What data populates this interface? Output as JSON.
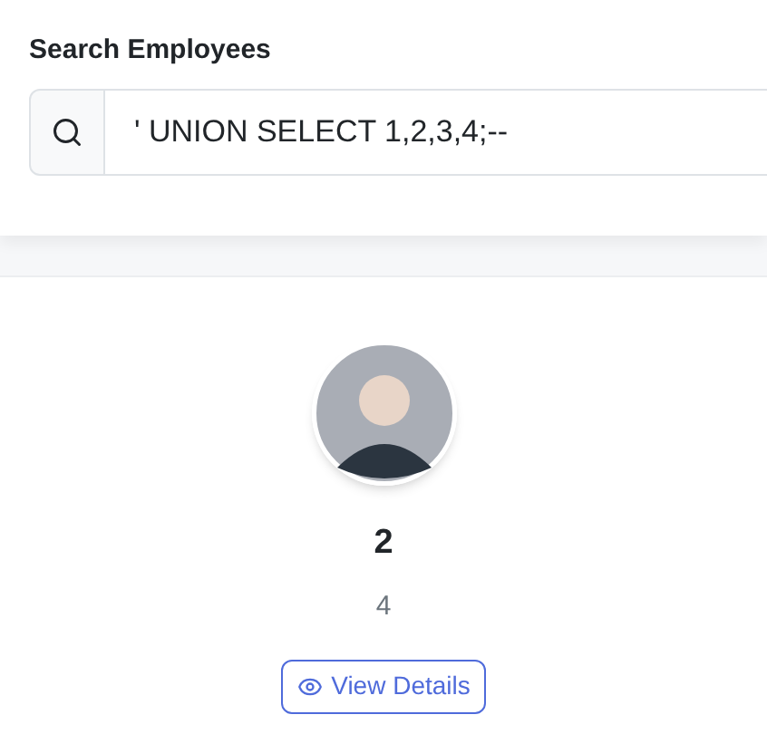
{
  "search": {
    "label": "Search Employees",
    "value": "' UNION SELECT 1,2,3,4;--"
  },
  "employees": [
    {
      "name": "2",
      "subtitle": "4",
      "action": "View Details"
    }
  ]
}
